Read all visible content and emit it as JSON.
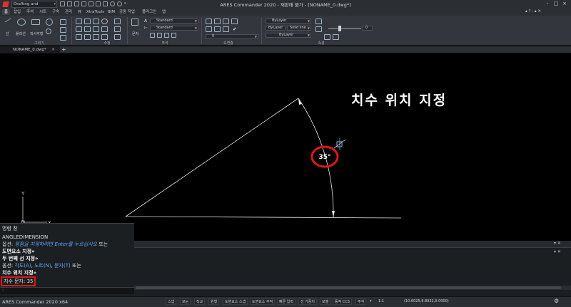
{
  "titlebar": {
    "title": "ARES Commander 2020 - 재판매 불가 - [NONAME_0.dwg*]",
    "workspace": "Drafting and Annotation",
    "workspace_arrow": "▾",
    "qa_tail": "▾ ·",
    "controls": [
      "-",
      "□",
      "×"
    ],
    "right_icons": "▴ ? - ▴ ✕"
  },
  "ribbon_tabs": [
    "홈",
    "삽입",
    "주석",
    "시트",
    "구속",
    "관리",
    "뷰",
    "XtraTools",
    "BIM",
    "공동 작업",
    "플러그인",
    "앱"
  ],
  "ribbon": {
    "groups": [
      "그리기",
      "수정",
      "주석",
      "도면층",
      "속성"
    ],
    "text_style": "Standard",
    "dim_style": "Standard",
    "color": "ByLayer",
    "layer_combo": "ByLayer",
    "linetype": "Solid line",
    "lineweight": "ByLayer",
    "layer_state": "0",
    "transparency_value": "0",
    "labels": {
      "line": "선",
      "polyline": "폴리선",
      "rect": "직사각형",
      "text": "문자",
      "layer": "ByLayer"
    }
  },
  "doc_tab": {
    "name": "NONAME_0.dwg*",
    "close": "×",
    "add": "+"
  },
  "drawing": {
    "dimension_text": "35°",
    "overlay_label": "치수 위치 지정",
    "ucs_x": "X",
    "ucs_y": "Y"
  },
  "command_panel": {
    "header": "명령 창",
    "lines": {
      "cmd": "ANGLEDIMENSION",
      "opt1_prefix": "옵션: ",
      "opt1_link": "정점을 지정하려면 Enter를 누르십시오",
      "opt1_suffix": " 또는",
      "entity_prompt": "도면요소 지정»",
      "second_line": "두 번째 선 지정»",
      "opt2_prefix": "옵션: ",
      "opt2_a": "각도(A)",
      "opt2_sep1": ", ",
      "opt2_b": "노트(N)",
      "opt2_sep2": ", ",
      "opt2_c": "문자(T)",
      "opt2_suffix": " 또는",
      "position_prompt": "치수 위치 지정»",
      "dim_text": "치수 문자: 35"
    },
    "prompt": ":"
  },
  "right_panel": {
    "controls": "▾ ✕"
  },
  "statusbar": {
    "app": "ARES Commander 2020 x64",
    "buttons": [
      "스냅",
      "모눈",
      "직교",
      "원형",
      "도면요소 스냅",
      "도면요소 추적",
      "빠른 입력",
      "선 가중치",
      "모델",
      "동적 CCS",
      "주석",
      "▾",
      "1:1"
    ],
    "coords": "(10.6025,9.8932,0.0000)",
    "gear": "⚙"
  },
  "colors": {
    "accent_red": "#e01717",
    "link_blue": "#5aa7ff",
    "background": "#000000"
  }
}
